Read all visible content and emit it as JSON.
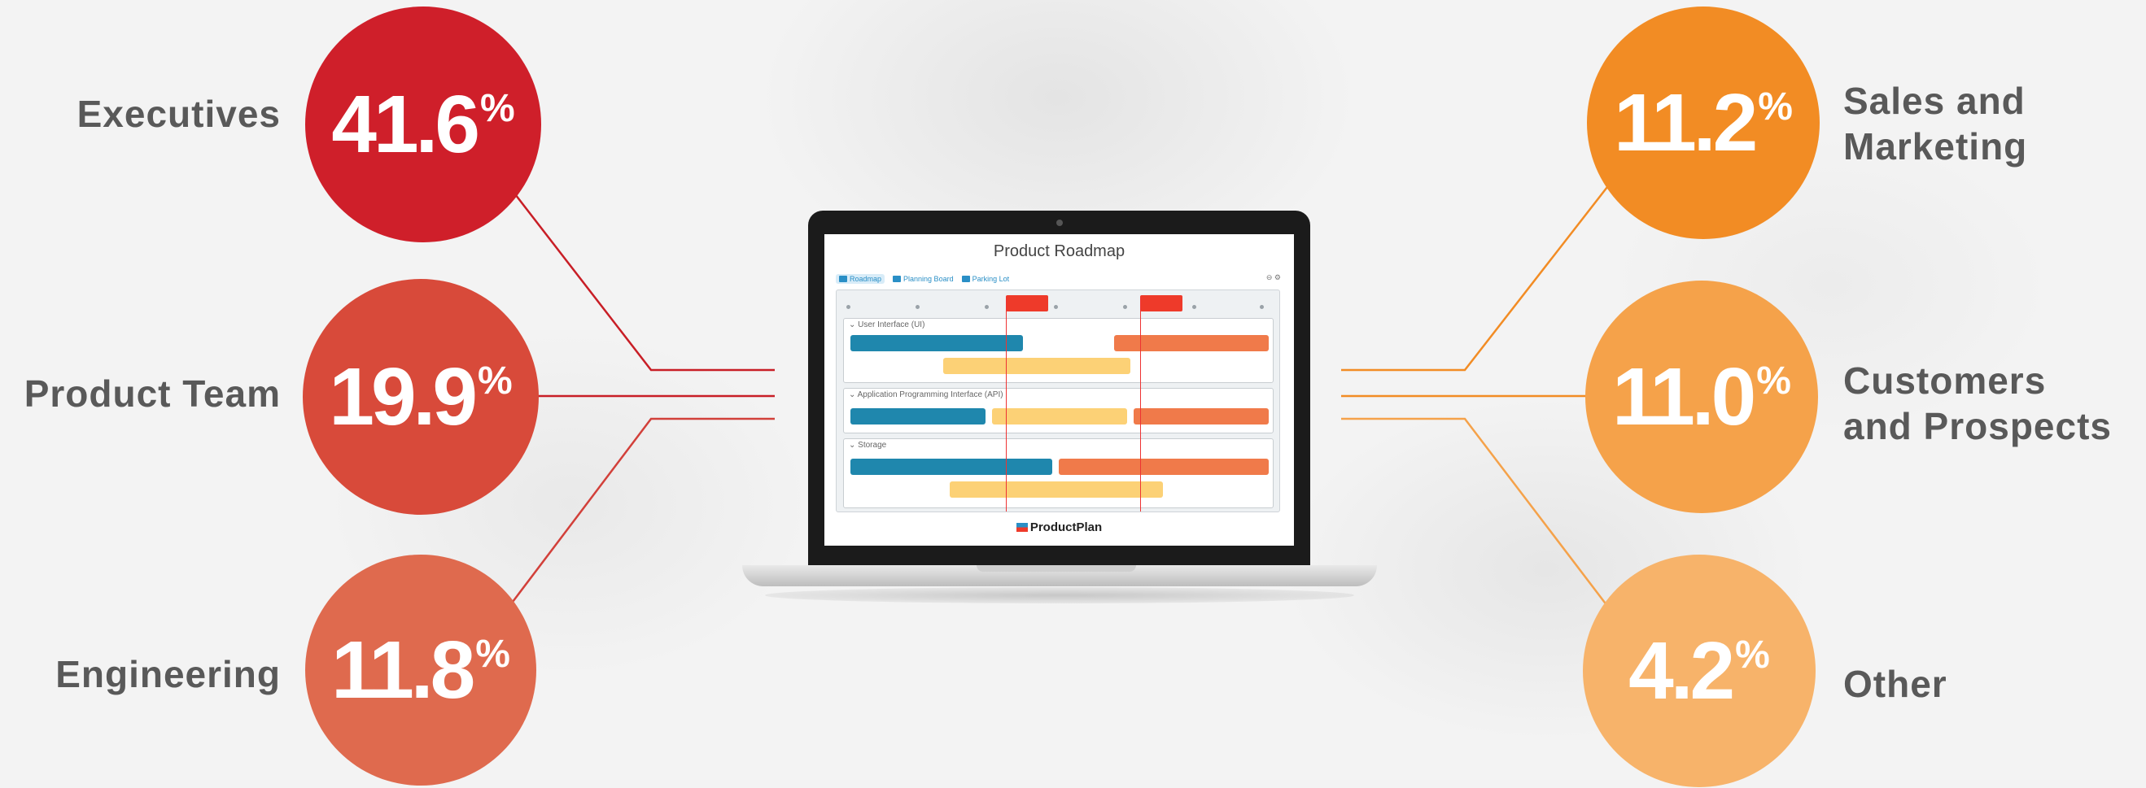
{
  "segments": [
    {
      "label": "Executives",
      "value": "41.6",
      "sign": "%",
      "color": "#cf1f2a"
    },
    {
      "label": "Product Team",
      "value": "19.9",
      "sign": "%",
      "color": "#d84a3a"
    },
    {
      "label": "Engineering",
      "value": "11.8",
      "sign": "%",
      "color": "#df6a4e"
    },
    {
      "label_line1": "Sales and",
      "label_line2": "Marketing",
      "value": "11.2",
      "sign": "%",
      "color": "#f28c24"
    },
    {
      "label_line1": "Customers",
      "label_line2": "and Prospects",
      "value": "11.0",
      "sign": "%",
      "color": "#f5a24a"
    },
    {
      "label": "Other",
      "value": "4.2",
      "sign": "%",
      "color": "#f7b36a"
    }
  ],
  "screen": {
    "title": "Product Roadmap",
    "tabs": [
      "Roadmap",
      "Planning Board",
      "Parking Lot"
    ],
    "lanes": [
      "User Interface (UI)",
      "Application Programming Interface (API)",
      "Storage"
    ],
    "brand": "ProductPlan"
  }
}
